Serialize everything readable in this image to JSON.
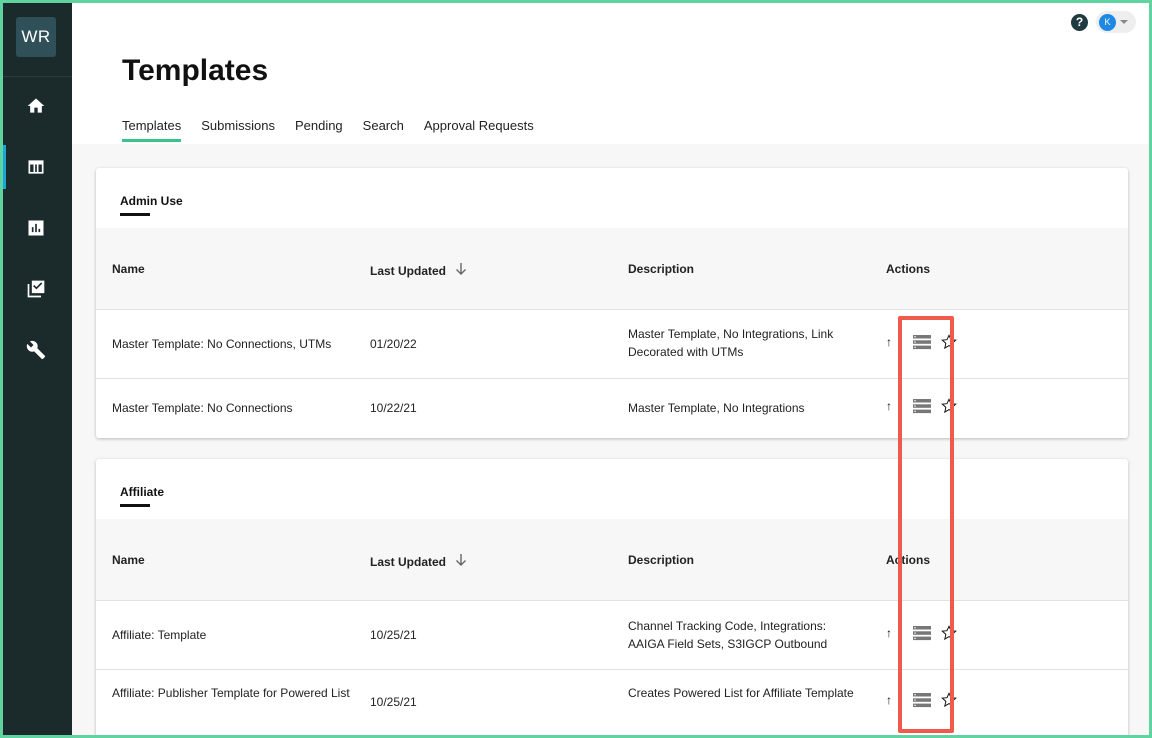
{
  "app": {
    "logo_text": "WR"
  },
  "sidebar": {
    "items": [
      {
        "name": "home",
        "icon": "home-icon"
      },
      {
        "name": "templates",
        "icon": "table-icon",
        "active": true
      },
      {
        "name": "reports",
        "icon": "chart-icon"
      },
      {
        "name": "approvals",
        "icon": "checklist-icon"
      },
      {
        "name": "tools",
        "icon": "wrench-icon"
      }
    ]
  },
  "header": {
    "help_symbol": "?",
    "user_initial": "K",
    "title": "Templates"
  },
  "tabs": [
    {
      "label": "Templates",
      "active": true
    },
    {
      "label": "Submissions"
    },
    {
      "label": "Pending"
    },
    {
      "label": "Search"
    },
    {
      "label": "Approval Requests"
    }
  ],
  "columns": {
    "name": "Name",
    "last_updated": "Last Updated",
    "description": "Description",
    "actions": "Actions"
  },
  "groups": [
    {
      "title": "Admin Use",
      "rows": [
        {
          "name": "Master Template: No Connections, UTMs",
          "last_updated": "01/20/22",
          "description": "Master Template, No Integrations, Link Decorated with UTMs"
        },
        {
          "name": "Master Template: No Connections",
          "last_updated": "10/22/21",
          "description": "Master Template, No Integrations"
        }
      ]
    },
    {
      "title": "Affiliate",
      "rows": [
        {
          "name": "Affiliate: Template",
          "last_updated": "10/25/21",
          "description": "Channel Tracking Code, Integrations: AAIGA Field Sets, S3IGCP Outbound"
        },
        {
          "name": "Affiliate: Publisher Template for Powered List",
          "last_updated": "10/25/21",
          "description": "Creates Powered List for Affiliate Template"
        }
      ]
    }
  ],
  "action_icons": {
    "up": "↑",
    "list": "list-icon",
    "star": "star-icon"
  },
  "colors": {
    "accent": "#37c389",
    "sidebar": "#1b2b2c",
    "highlight": "#f05a4c",
    "frame": "#5fd3a0"
  }
}
